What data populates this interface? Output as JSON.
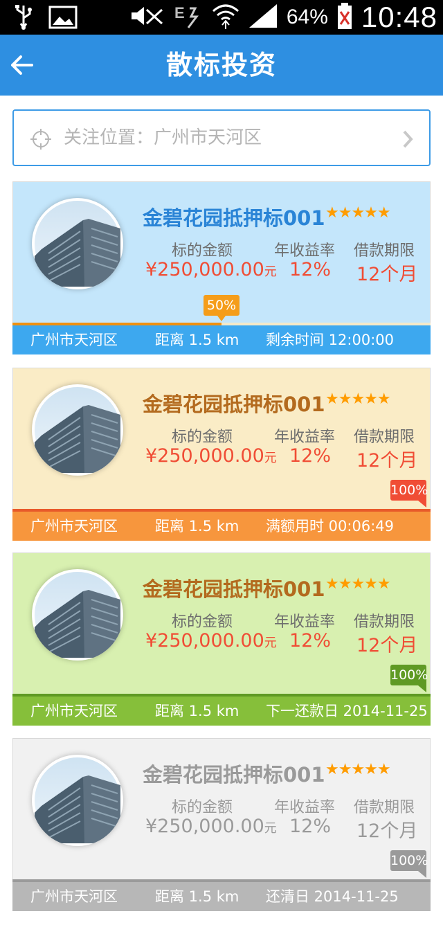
{
  "status_bar": {
    "battery_percent": "64%",
    "time": "10:48",
    "icons": [
      "usb-icon",
      "image-icon",
      "mute-icon",
      "signal-e-icon",
      "wifi-icon",
      "cell-signal-icon",
      "battery-icon"
    ]
  },
  "header": {
    "title": "散标投资",
    "back_icon": "back-arrow-icon"
  },
  "location": {
    "label": "关注位置：广州市天河区",
    "icon": "target-icon"
  },
  "colors": {
    "brand": "#2e8fe1",
    "accent_red": "#f04d35",
    "star": "#ff9c00"
  },
  "cards": [
    {
      "title": "金碧花园抵押标001",
      "stars": "★★★★★",
      "amount_label": "标的金额",
      "amount_value": "¥250,000.00",
      "amount_unit": "元",
      "rate_label": "年收益率",
      "rate_value": "12%",
      "term_label": "借款期限",
      "term_value": "12个月",
      "location": "广州市天河区",
      "distance": "距离 1.5 km",
      "status": "剩余时间 12:00:00",
      "progress": 0.5,
      "badge": "50%",
      "theme": "blue"
    },
    {
      "title": "金碧花园抵押标001",
      "stars": "★★★★★",
      "amount_label": "标的金额",
      "amount_value": "¥250,000.00",
      "amount_unit": "元",
      "rate_label": "年收益率",
      "rate_value": "12%",
      "term_label": "借款期限",
      "term_value": "12个月",
      "location": "广州市天河区",
      "distance": "距离 1.5 km",
      "status": "满额用时 00:06:49",
      "progress": 1.0,
      "badge": "100%",
      "theme": "orange"
    },
    {
      "title": "金碧花园抵押标001",
      "stars": "★★★★★",
      "amount_label": "标的金额",
      "amount_value": "¥250,000.00",
      "amount_unit": "元",
      "rate_label": "年收益率",
      "rate_value": "12%",
      "term_label": "借款期限",
      "term_value": "12个月",
      "location": "广州市天河区",
      "distance": "距离 1.5 km",
      "status": "下一还款日 2014-11-25",
      "progress": 1.0,
      "badge": "100%",
      "theme": "green"
    },
    {
      "title": "金碧花园抵押标001",
      "stars": "★★★★★",
      "amount_label": "标的金额",
      "amount_value": "¥250,000.00",
      "amount_unit": "元",
      "rate_label": "年收益率",
      "rate_value": "12%",
      "term_label": "借款期限",
      "term_value": "12个月",
      "location": "广州市天河区",
      "distance": "距离 1.5 km",
      "status": "还清日 2014-11-25",
      "progress": 1.0,
      "badge": "100%",
      "theme": "gray"
    }
  ]
}
